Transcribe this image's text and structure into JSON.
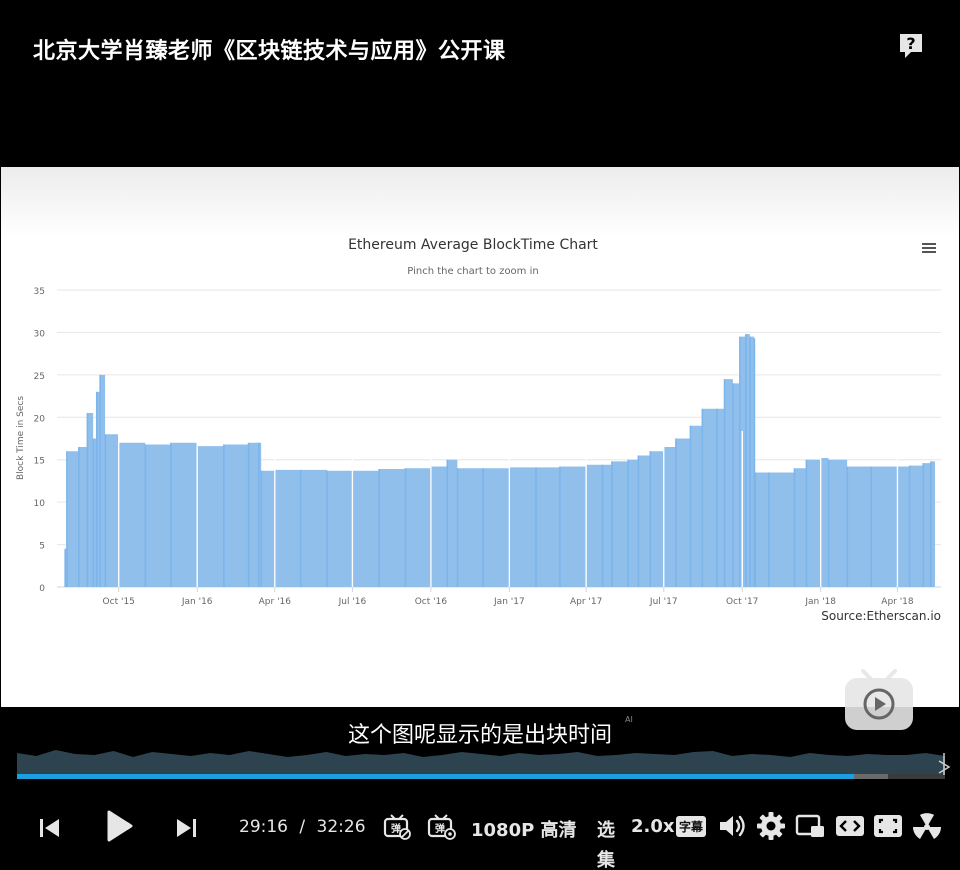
{
  "video": {
    "title": "北京大学肖臻老师《区块链技术与应用》公开课",
    "subtitle": "这个图呢显示的是出块时间",
    "subtitle_ai_tag": "AI"
  },
  "player": {
    "current_time": "29:16",
    "time_separator": "/",
    "total_time": "32:26",
    "progress_fraction": 0.902,
    "quality_label": "1080P 高清",
    "episodes_label": "选集",
    "speed_label": "2.0x",
    "subtitles_label": "字幕"
  },
  "chart_data": {
    "type": "bar",
    "title": "Ethereum Average BlockTime Chart",
    "subtitle": "Pinch the chart to zoom in",
    "ylabel": "Block Time in Secs",
    "ylim": [
      0,
      35
    ],
    "yticks": [
      0,
      5,
      10,
      15,
      20,
      25,
      30,
      35
    ],
    "xlim": [
      "2015-07-30",
      "2018-05-15"
    ],
    "xticks": [
      {
        "date": "2015-10-01",
        "label": "Oct '15"
      },
      {
        "date": "2016-01-01",
        "label": "Jan '16"
      },
      {
        "date": "2016-04-01",
        "label": "Apr '16"
      },
      {
        "date": "2016-07-01",
        "label": "Jul '16"
      },
      {
        "date": "2016-10-01",
        "label": "Oct '16"
      },
      {
        "date": "2017-01-01",
        "label": "Jan '17"
      },
      {
        "date": "2017-04-01",
        "label": "Apr '17"
      },
      {
        "date": "2017-07-01",
        "label": "Jul '17"
      },
      {
        "date": "2017-10-01",
        "label": "Oct '17"
      },
      {
        "date": "2018-01-01",
        "label": "Jan '18"
      },
      {
        "date": "2018-04-01",
        "label": "Apr '18"
      }
    ],
    "series": [
      {
        "x": [
          "2015-07-30",
          "2015-08-01",
          "2015-08-15",
          "2015-08-25",
          "2015-09-01",
          "2015-09-05",
          "2015-09-09",
          "2015-09-15",
          "2015-10-01",
          "2015-11-01",
          "2015-12-01",
          "2016-01-01",
          "2016-02-01",
          "2016-03-01",
          "2016-03-13",
          "2016-03-16",
          "2016-04-01",
          "2016-05-01",
          "2016-06-01",
          "2016-07-01",
          "2016-08-01",
          "2016-09-01",
          "2016-10-01",
          "2016-10-20",
          "2016-11-01",
          "2016-12-01",
          "2017-01-01",
          "2017-02-01",
          "2017-03-01",
          "2017-04-01",
          "2017-04-20",
          "2017-05-01",
          "2017-05-20",
          "2017-06-01",
          "2017-06-15",
          "2017-07-01",
          "2017-07-15",
          "2017-08-01",
          "2017-08-15",
          "2017-09-01",
          "2017-09-10",
          "2017-09-20",
          "2017-09-28",
          "2017-10-05",
          "2017-10-10",
          "2017-10-15",
          "2017-10-16",
          "2017-11-01",
          "2017-12-01",
          "2017-12-15",
          "2018-01-01",
          "2018-01-10",
          "2018-02-01",
          "2018-03-01",
          "2018-04-01",
          "2018-04-15",
          "2018-05-01",
          "2018-05-10"
        ],
        "values": [
          4.5,
          16.0,
          16.5,
          20.5,
          17.5,
          23.0,
          25.0,
          18.0,
          17.0,
          16.8,
          17.0,
          16.6,
          16.8,
          17.0,
          17.0,
          13.7,
          13.8,
          13.8,
          13.7,
          13.7,
          13.9,
          14.0,
          14.2,
          15.0,
          14.0,
          14.0,
          14.1,
          14.1,
          14.2,
          14.4,
          14.4,
          14.8,
          15.0,
          15.5,
          16.0,
          16.5,
          17.5,
          19.0,
          21.0,
          21.0,
          24.5,
          24.0,
          29.5,
          29.8,
          29.5,
          29.3,
          13.5,
          13.5,
          14.0,
          15.0,
          15.2,
          15.0,
          14.2,
          14.2,
          14.2,
          14.3,
          14.6,
          14.8
        ]
      }
    ],
    "annotations": [
      "Source:Etherscan.io"
    ]
  }
}
